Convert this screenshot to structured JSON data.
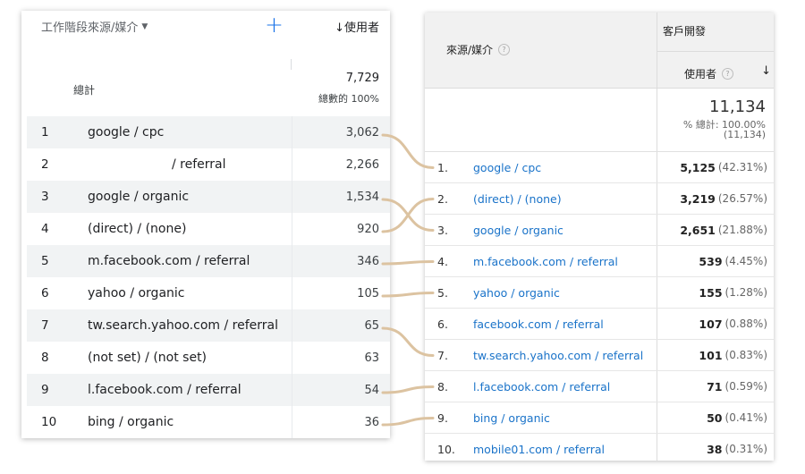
{
  "left": {
    "dimension_label": "工作階段來源/媒介",
    "plus_label": "+",
    "metric_label": "↓使用者",
    "total_label": "總計",
    "total_value": "7,729",
    "total_pct": "總數的 100%",
    "rows": [
      {
        "index": "1",
        "name": "google / cpc",
        "value": "3,062"
      },
      {
        "index": "2",
        "name": "/ referral",
        "value": "2,266"
      },
      {
        "index": "3",
        "name": "google / organic",
        "value": "1,534"
      },
      {
        "index": "4",
        "name": "(direct) / (none)",
        "value": "920"
      },
      {
        "index": "5",
        "name": "m.facebook.com / referral",
        "value": "346"
      },
      {
        "index": "6",
        "name": "yahoo / organic",
        "value": "105"
      },
      {
        "index": "7",
        "name": "tw.search.yahoo.com / referral",
        "value": "65"
      },
      {
        "index": "8",
        "name": "(not set) / (not set)",
        "value": "63"
      },
      {
        "index": "9",
        "name": "l.facebook.com / referral",
        "value": "54"
      },
      {
        "index": "10",
        "name": "bing / organic",
        "value": "36"
      }
    ]
  },
  "right": {
    "source_title": "來源/媒介",
    "group_title": "客戶開發",
    "metric_title": "使用者",
    "sort_icon": "↓",
    "help_icon": "?",
    "total_value": "11,134",
    "total_pct": "% 總計: 100.00%",
    "total_abs": "(11,134)",
    "rows": [
      {
        "index": "1.",
        "name": "google / cpc",
        "value": "5,125",
        "pct": "(42.31%)"
      },
      {
        "index": "2.",
        "name": "(direct) / (none)",
        "value": "3,219",
        "pct": "(26.57%)"
      },
      {
        "index": "3.",
        "name": "google / organic",
        "value": "2,651",
        "pct": "(21.88%)"
      },
      {
        "index": "4.",
        "name": "m.facebook.com / referral",
        "value": "539",
        "pct": "(4.45%)"
      },
      {
        "index": "5.",
        "name": "yahoo / organic",
        "value": "155",
        "pct": "(1.28%)"
      },
      {
        "index": "6.",
        "name": "facebook.com / referral",
        "value": "107",
        "pct": "(0.88%)"
      },
      {
        "index": "7.",
        "name": "tw.search.yahoo.com / referral",
        "value": "101",
        "pct": "(0.83%)"
      },
      {
        "index": "8.",
        "name": "l.facebook.com / referral",
        "value": "71",
        "pct": "(0.59%)"
      },
      {
        "index": "9.",
        "name": "bing / organic",
        "value": "50",
        "pct": "(0.41%)"
      },
      {
        "index": "10.",
        "name": "mobile01.com / referral",
        "value": "38",
        "pct": "(0.31%)"
      }
    ]
  },
  "colors": {
    "connector": "#dcc3a1",
    "link": "#1a73c9",
    "accent": "#1a73e8"
  },
  "connections": [
    {
      "from_left_index": "1",
      "to_right_index": "1."
    },
    {
      "from_left_index": "3",
      "to_right_index": "3."
    },
    {
      "from_left_index": "4",
      "to_right_index": "2."
    },
    {
      "from_left_index": "5",
      "to_right_index": "4."
    },
    {
      "from_left_index": "6",
      "to_right_index": "5."
    },
    {
      "from_left_index": "7",
      "to_right_index": "7."
    },
    {
      "from_left_index": "9",
      "to_right_index": "8."
    },
    {
      "from_left_index": "10",
      "to_right_index": "9."
    }
  ]
}
